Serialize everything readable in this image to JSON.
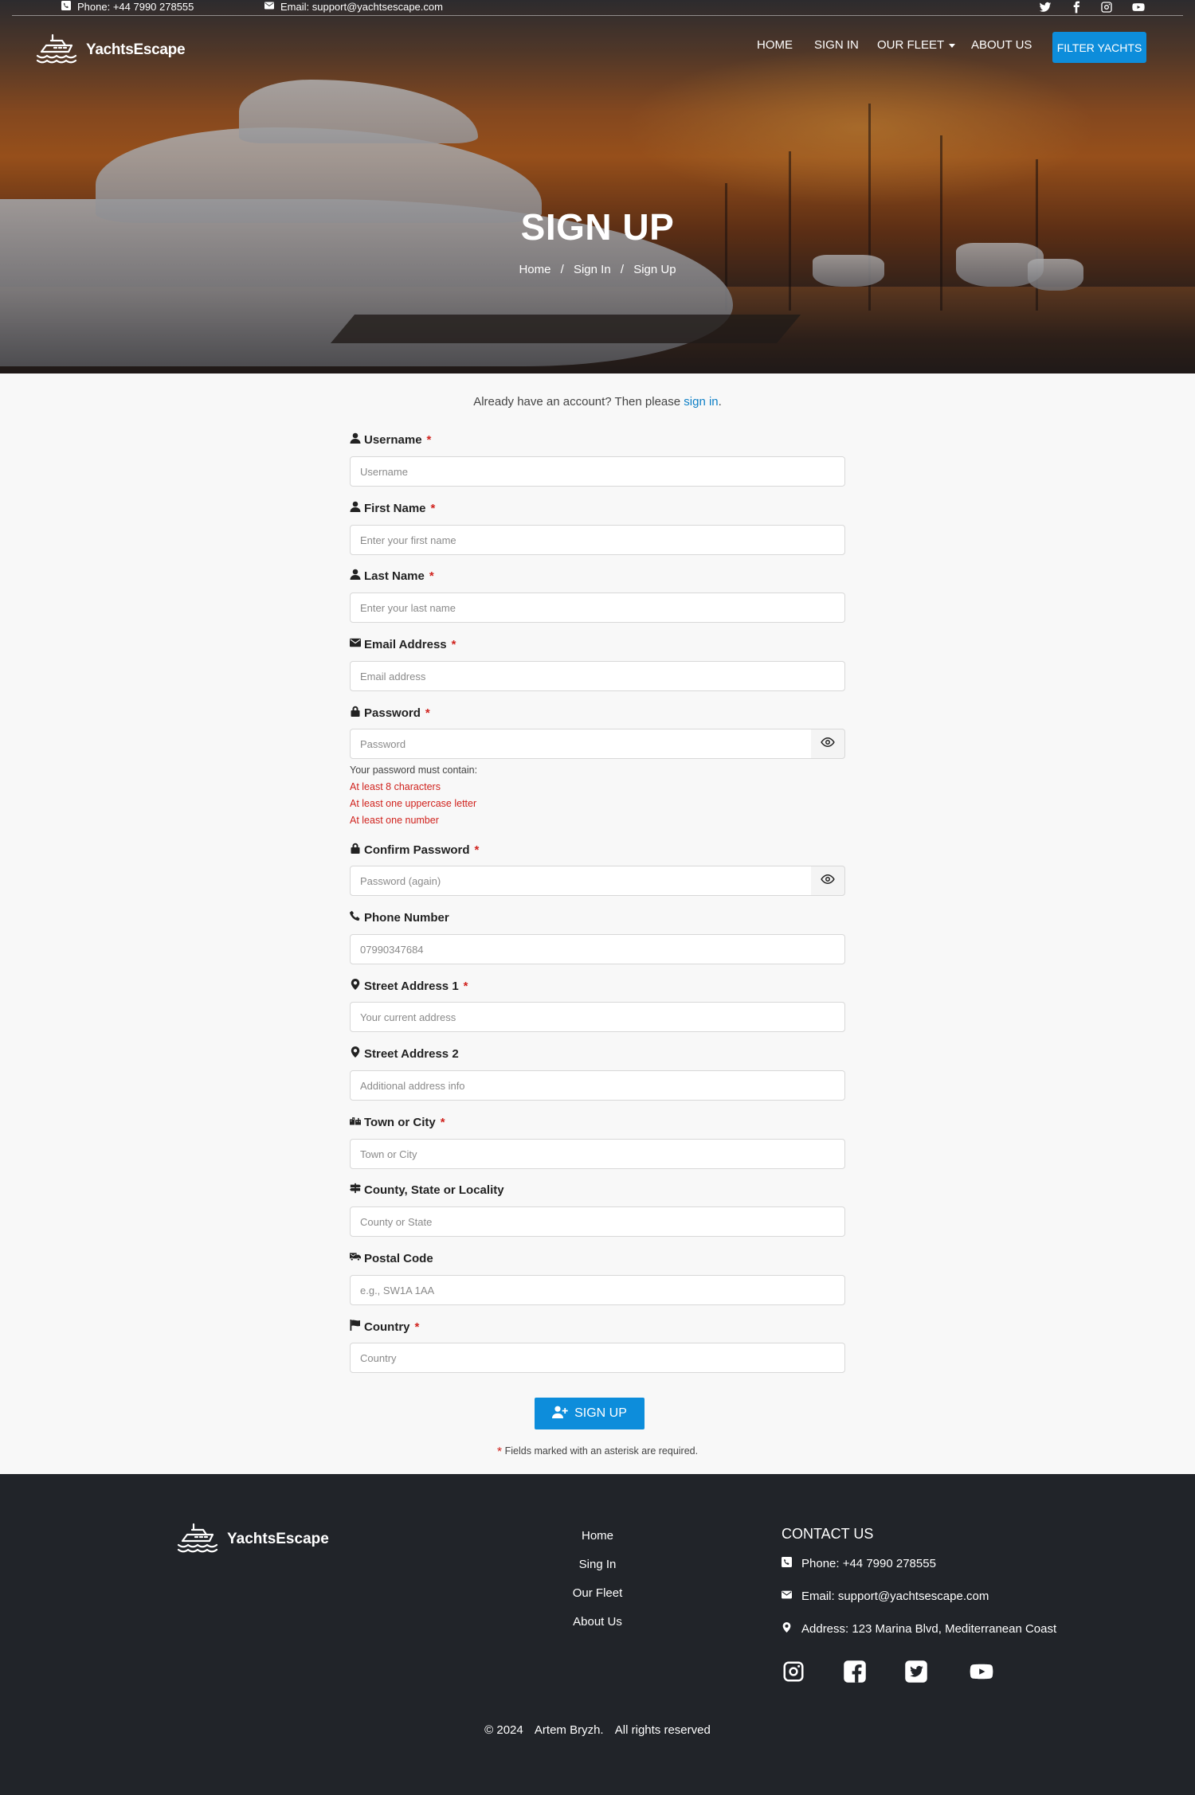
{
  "topbar": {
    "phone": "Phone: +44 7990 278555",
    "email": "Email: support@yachtsescape.com"
  },
  "brand": {
    "name": "YachtsEscape"
  },
  "nav": {
    "home": "HOME",
    "sign_in": "SIGN IN",
    "our_fleet": "OUR FLEET",
    "about_us": "ABOUT US",
    "filter_yachts": "FILTER YACHTS"
  },
  "hero": {
    "title": "SIGN UP",
    "breadcrumb": {
      "home": "Home",
      "sep": "/",
      "sign_in": "Sign In",
      "current": "Sign Up"
    }
  },
  "form": {
    "signin_prompt": "Already have an account? Then please",
    "signin_link": "sign in",
    "signin_end": ".",
    "required_mark": "*",
    "fields": {
      "username": {
        "label": "Username",
        "placeholder": "Username"
      },
      "first_name": {
        "label": "First Name",
        "placeholder": "Enter your first name"
      },
      "last_name": {
        "label": "Last Name",
        "placeholder": "Enter your last name"
      },
      "email": {
        "label": "Email Address",
        "placeholder": "Email address"
      },
      "password": {
        "label": "Password",
        "placeholder": "Password"
      },
      "confirm_password": {
        "label": "Confirm Password",
        "placeholder": "Password (again)"
      },
      "phone": {
        "label": "Phone Number",
        "placeholder": "07990347684"
      },
      "street1": {
        "label": "Street Address 1",
        "placeholder": "Your current address"
      },
      "street2": {
        "label": "Street Address 2",
        "placeholder": "Additional address info"
      },
      "town": {
        "label": "Town or City",
        "placeholder": "Town or City"
      },
      "county": {
        "label": "County, State or Locality",
        "placeholder": "County or State"
      },
      "postal": {
        "label": "Postal Code",
        "placeholder": "e.g., SW1A 1AA"
      },
      "country": {
        "label": "Country",
        "placeholder": "Country"
      }
    },
    "password_rules": {
      "heading": "Your password must contain:",
      "rules": [
        "At least 8 characters",
        "At least one uppercase letter",
        "At least one number"
      ]
    },
    "submit_label": "SIGN UP",
    "required_note": "Fields marked with an asterisk are required."
  },
  "footer": {
    "brand": "YachtsEscape",
    "links": [
      "Home",
      "Sing In",
      "Our Fleet",
      "About Us"
    ],
    "contact_heading": "CONTACT US",
    "phone": "Phone: +44 7990 278555",
    "email": "Email: support@yachtsescape.com",
    "address": "Address: 123 Marina Blvd, Mediterranean Coast",
    "copyright": {
      "year": "© 2024",
      "author": "Artem Bryzh.",
      "rights": "All rights reserved"
    }
  },
  "icons": {
    "social": [
      "twitter-icon",
      "facebook-icon",
      "instagram-icon",
      "youtube-icon"
    ],
    "footer_social": [
      "instagram-icon",
      "facebook-square-icon",
      "twitter-square-icon",
      "youtube-icon"
    ]
  },
  "colors": {
    "accent": "#0d8ddb",
    "required": "#d0231e",
    "footer_bg": "#212429",
    "link": "#0d7fc6"
  }
}
